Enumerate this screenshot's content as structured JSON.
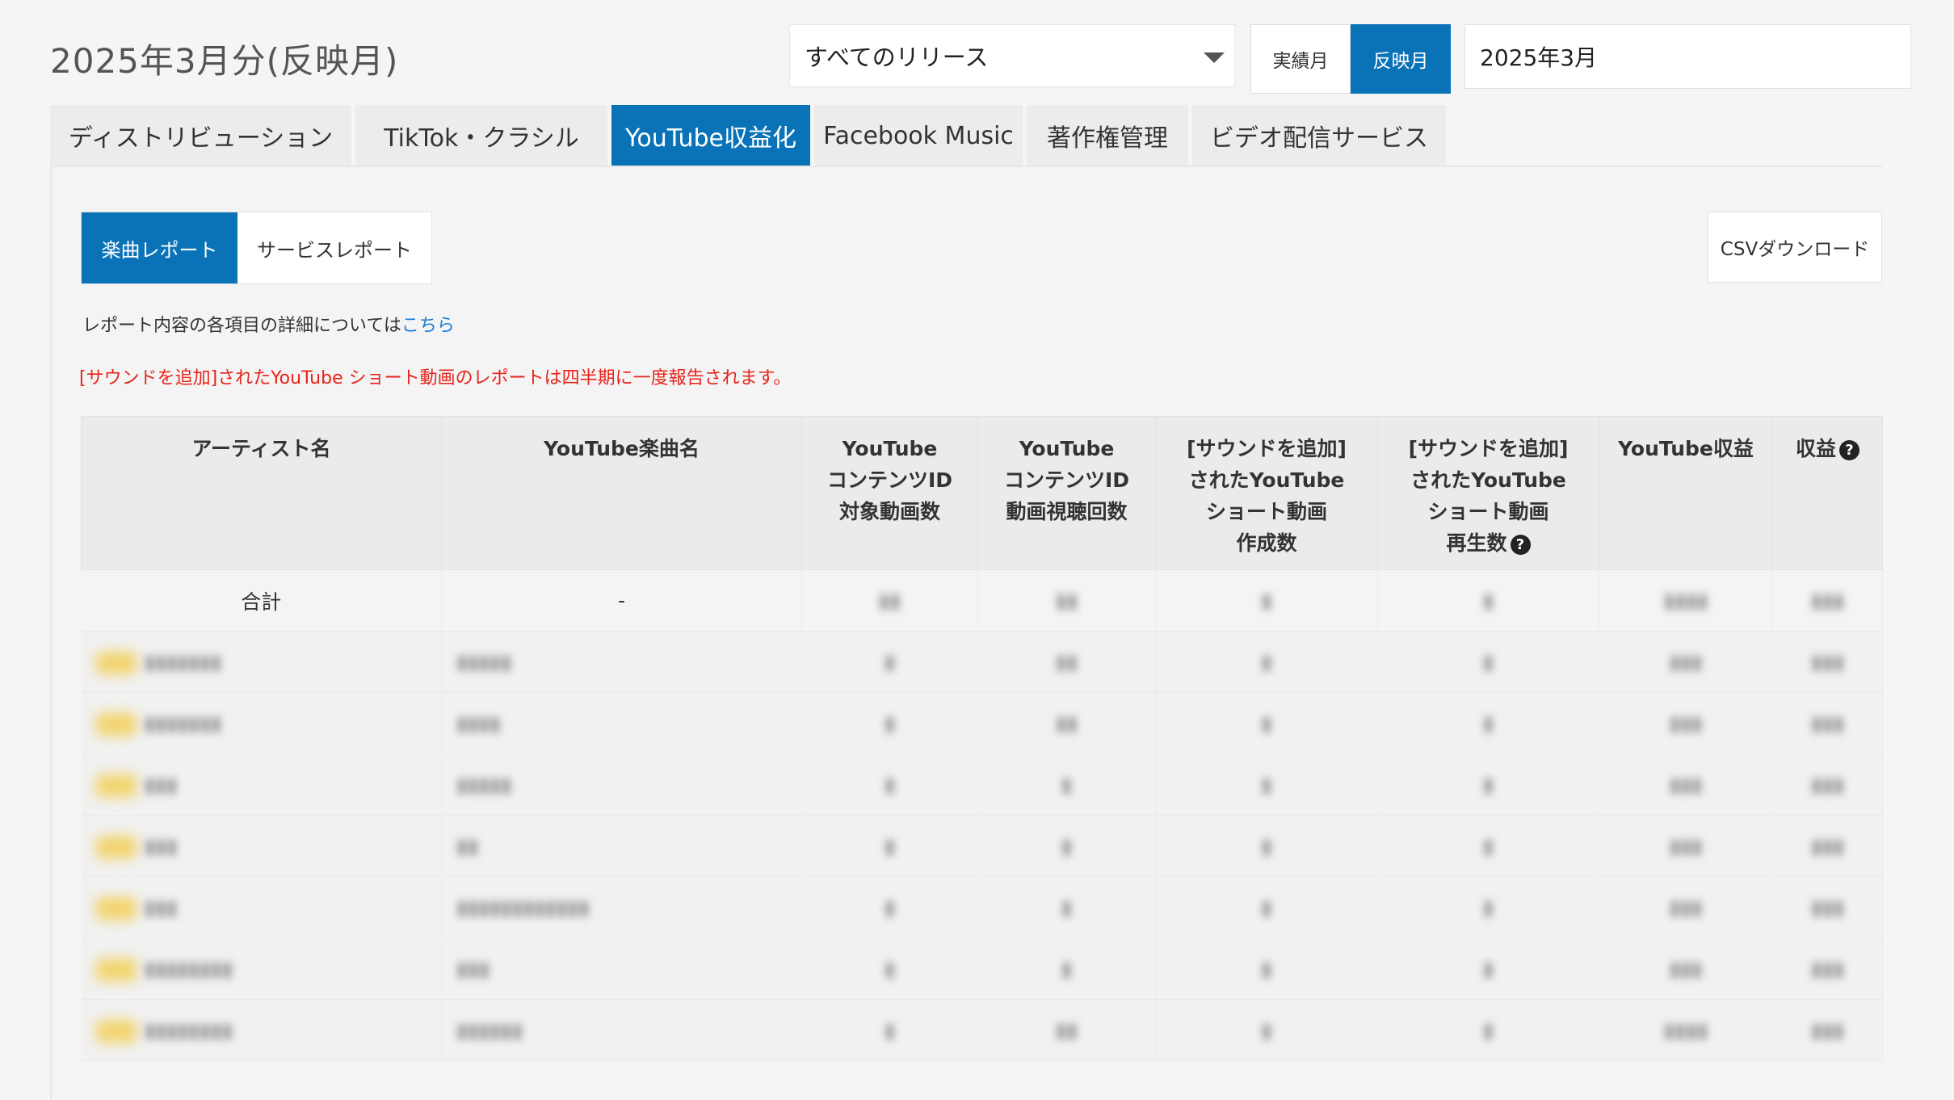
{
  "header": {
    "title": "2025年3月分(反映月)",
    "release_select": "すべてのリリース",
    "toggle_actual": "実績月",
    "toggle_reflect": "反映月",
    "month_value": "2025年3月"
  },
  "tabs": [
    {
      "label": "ディストリビューション"
    },
    {
      "label": "TikTok・クラシル"
    },
    {
      "label": "YouTube収益化"
    },
    {
      "label": "Facebook Music"
    },
    {
      "label": "著作権管理"
    },
    {
      "label": "ビデオ配信サービス"
    }
  ],
  "subtabs": {
    "songs": "楽曲レポート",
    "services": "サービスレポート"
  },
  "csv_button": "CSVダウンロード",
  "note": {
    "text": "レポート内容の各項目の詳細については",
    "link": "こちら"
  },
  "warning": "[サウンドを追加]されたYouTube ショート動画のレポートは四半期に一度報告されます。",
  "table": {
    "headers": {
      "artist": "アーティスト名",
      "song": "YouTube楽曲名",
      "cid_videos": [
        "YouTube",
        "コンテンツID",
        "対象動画数"
      ],
      "cid_views": [
        "YouTube",
        "コンテンツID",
        "動画視聴回数"
      ],
      "shorts_created": [
        "[サウンドを追加]",
        "されたYouTube",
        "ショート動画",
        "作成数"
      ],
      "shorts_plays": [
        "[サウンドを追加]",
        "されたYouTube",
        "ショート動画",
        "再生数"
      ],
      "yt_revenue": "YouTube収益",
      "revenue": "収益"
    },
    "total": {
      "label": "合計",
      "song": "-"
    }
  }
}
